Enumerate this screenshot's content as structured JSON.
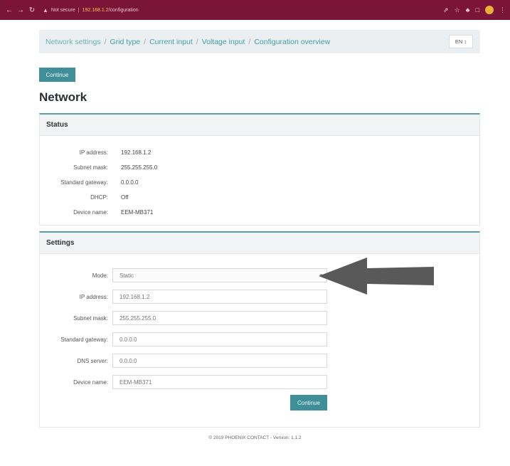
{
  "browser": {
    "security_label": "Not secure",
    "host": "192.168.1.2",
    "path": "/configuration"
  },
  "breadcrumb": {
    "items": [
      "Network settings",
      "Grid type",
      "Current input",
      "Voltage input",
      "Configuration overview"
    ],
    "language": "EN ↕"
  },
  "top_button_label": "Continue",
  "page_title": "Network",
  "status": {
    "heading": "Status",
    "rows": [
      {
        "label": "IP address:",
        "value": "192.168.1.2"
      },
      {
        "label": "Subnet mask:",
        "value": "255.255.255.0"
      },
      {
        "label": "Standard gateway:",
        "value": "0.0.0.0"
      },
      {
        "label": "DHCP:",
        "value": "Off"
      },
      {
        "label": "Device name:",
        "value": "EEM-MB371"
      }
    ]
  },
  "settings": {
    "heading": "Settings",
    "fields": [
      {
        "label": "Mode:",
        "value": "Static"
      },
      {
        "label": "IP address:",
        "value": "192.168.1.2"
      },
      {
        "label": "Subnet mask:",
        "value": "255.255.255.0"
      },
      {
        "label": "Standard gateway:",
        "value": "0.0.0.0"
      },
      {
        "label": "DNS server:",
        "value": "0.0.0.0"
      },
      {
        "label": "Device name:",
        "value": "EEM-MB371"
      }
    ],
    "submit_label": "Continue"
  },
  "footer": "© 2019 PHOENIX CONTACT - Version: 1.1.2",
  "colors": {
    "chrome": "#7a1538",
    "accent": "#3f8f99",
    "arrow": "#595959"
  }
}
